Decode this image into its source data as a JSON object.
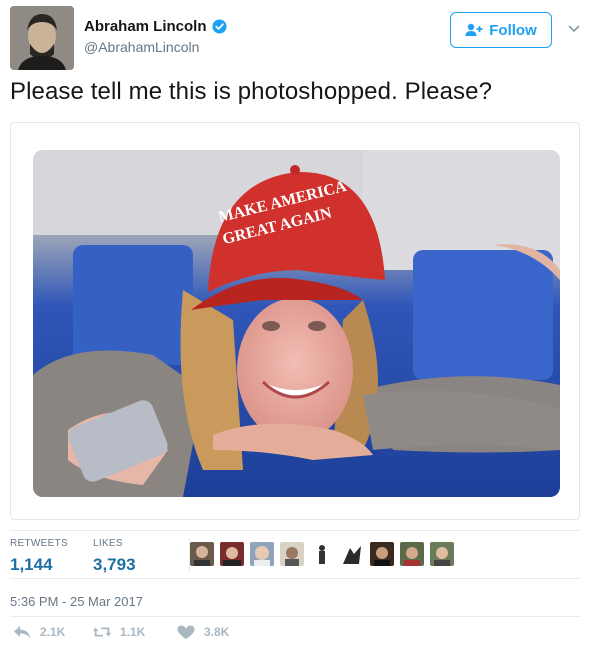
{
  "author": {
    "display_name": "Abraham Lincoln",
    "handle": "@AbrahamLincoln",
    "verified_icon": "verified-badge-icon",
    "verified_color": "#1da1f2"
  },
  "follow_button": {
    "label": "Follow",
    "icon": "add-user-icon",
    "color": "#1da1f2"
  },
  "tweet": {
    "text": "Please tell me this is photoshopped. Please?"
  },
  "media": {
    "hat_line1": "MAKE AMERICA",
    "hat_line2": "GREAT AGAIN"
  },
  "stats": {
    "retweets_label": "RETWEETS",
    "retweets_value": "1,144",
    "likes_label": "LIKES",
    "likes_value": "3,793",
    "value_color": "#1d6fa5"
  },
  "timestamp": "5:36 PM - 25 Mar 2017",
  "actions": {
    "reply_count": "2.1K",
    "retweet_count": "1.1K",
    "like_count": "3.8K",
    "icon_color": "#aab8c2"
  }
}
